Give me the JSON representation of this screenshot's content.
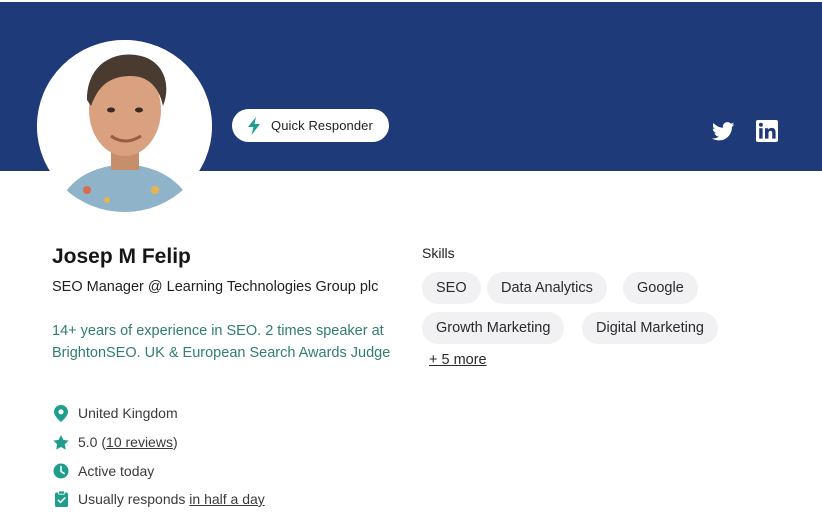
{
  "profile": {
    "name": "Josep M Felip",
    "role": "SEO Manager @ Learning Technologies Group plc",
    "bio": "14+ years of experience in SEO. 2 times speaker at BrightonSEO. UK & European Search Awards Judge"
  },
  "badge": {
    "label": "Quick Responder",
    "icon": "lightning-bolt-icon"
  },
  "social": [
    {
      "name": "twitter",
      "icon": "twitter-icon"
    },
    {
      "name": "linkedin",
      "icon": "linkedin-icon"
    }
  ],
  "meta": {
    "location": "United Kingdom",
    "rating": "5.0",
    "rating_open": "(",
    "reviews_link": "10 reviews",
    "rating_close": ")",
    "activity": "Active today",
    "responds_prefix": "Usually responds",
    "responds_link": "in half a day"
  },
  "skills": {
    "title": "Skills",
    "items": [
      "SEO",
      "Data Analytics",
      "Google",
      "Growth Marketing",
      "Digital Marketing"
    ],
    "more_label": "+ 5 more"
  },
  "colors": {
    "banner": "#1e3a78",
    "accent_teal": "#2f7d73",
    "icon_teal": "#1f9e8d",
    "chip_bg": "#f1f1f3"
  }
}
